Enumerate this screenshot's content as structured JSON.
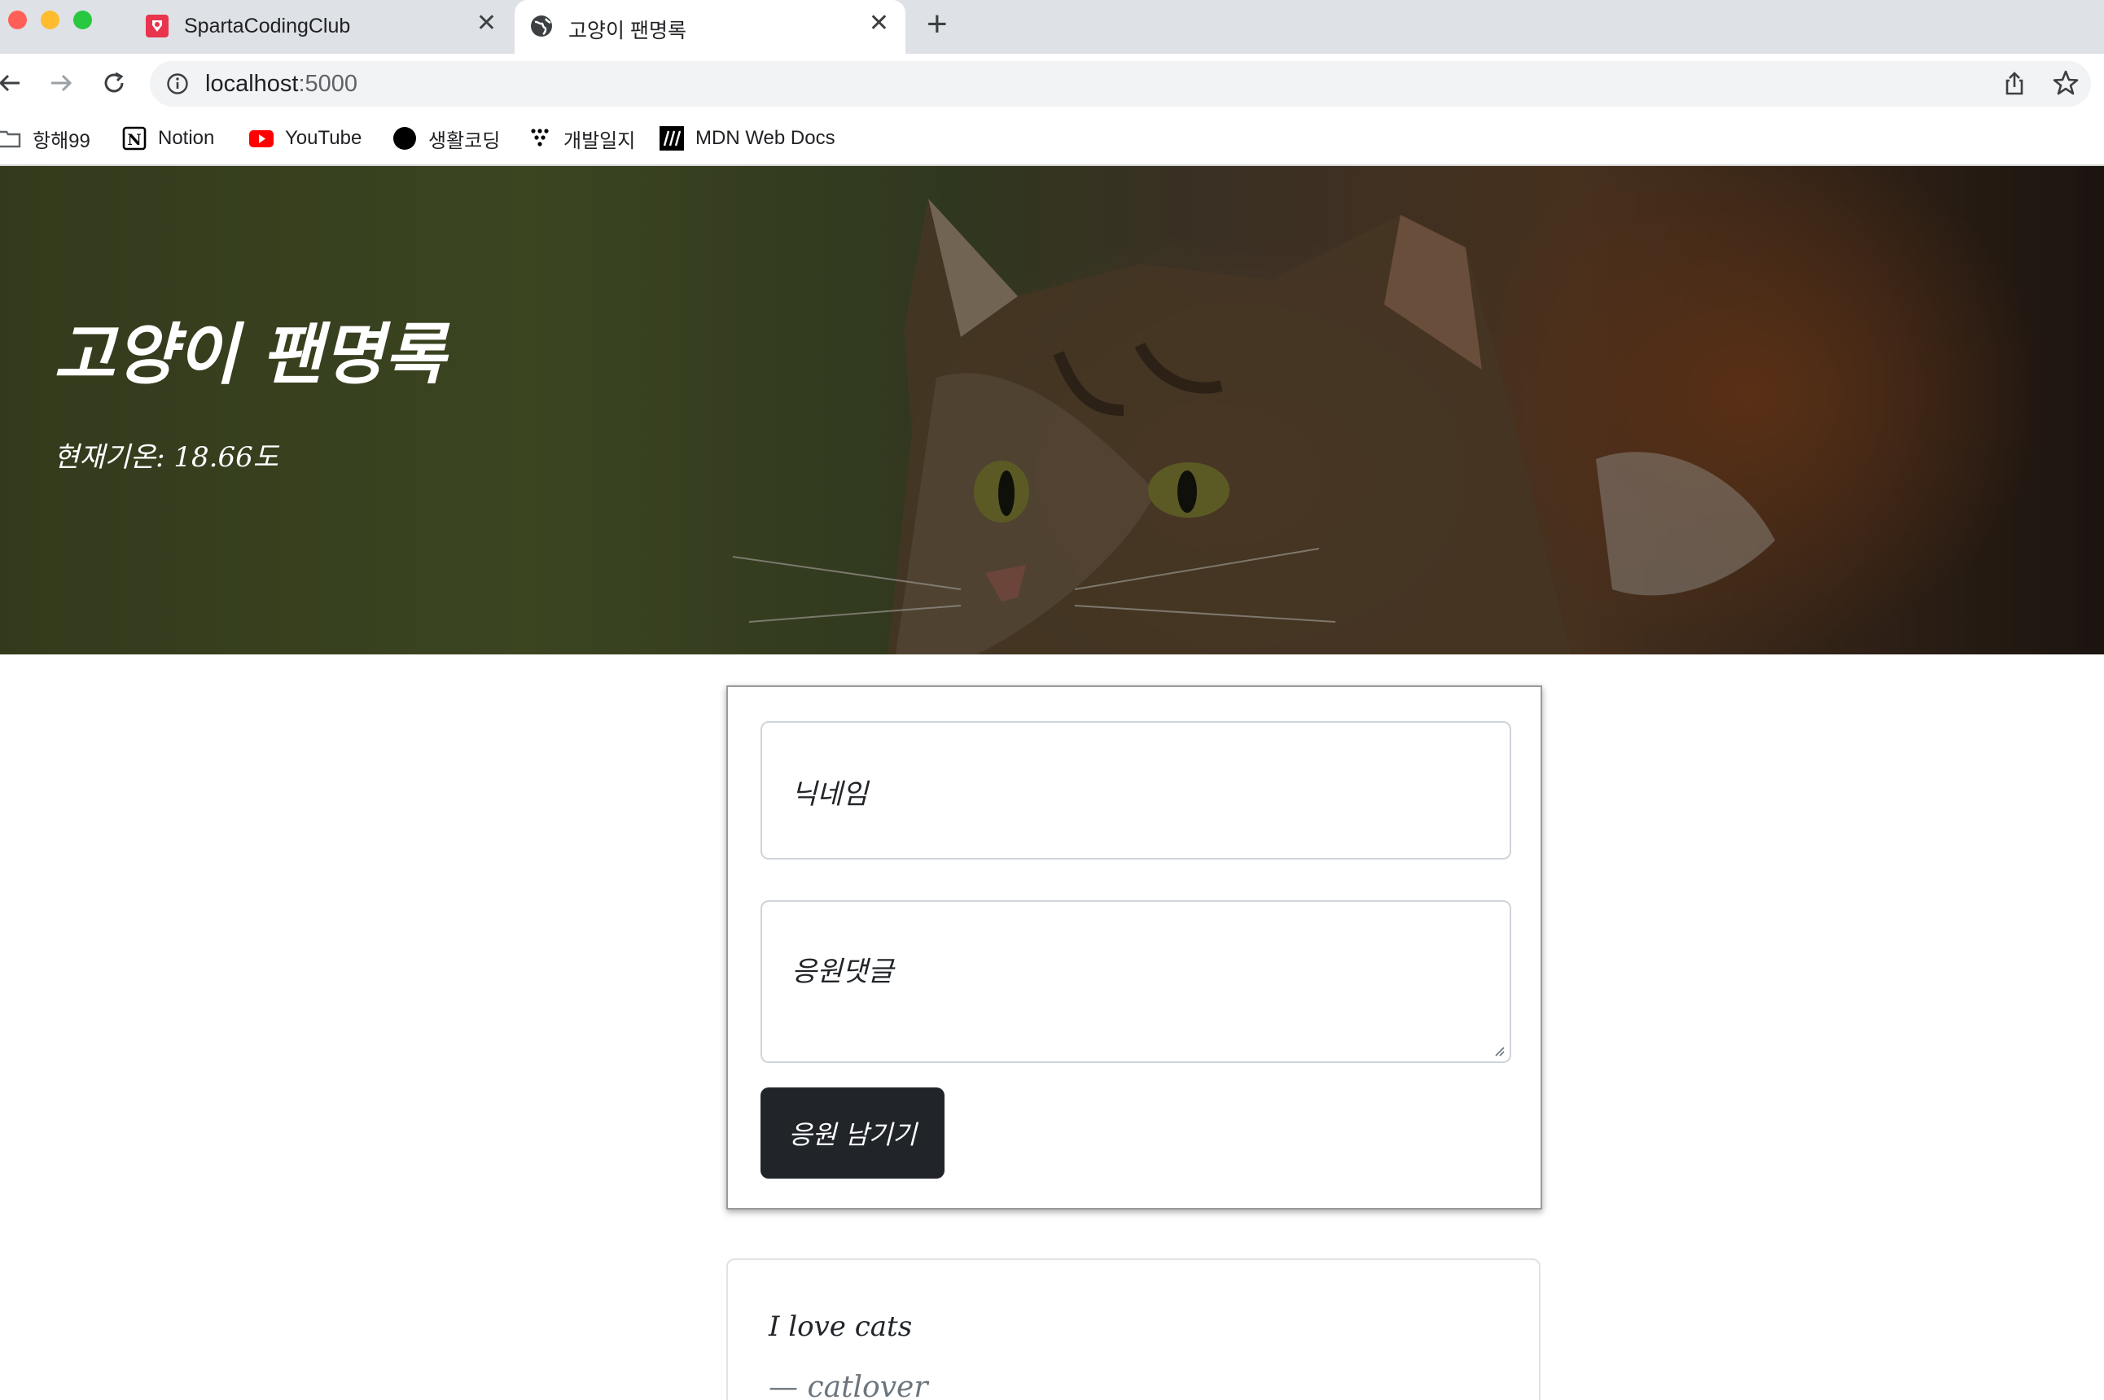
{
  "browser": {
    "tabs": [
      {
        "title": "SpartaCodingClub",
        "icon": "sparta-favicon",
        "close": "✕",
        "active": false
      },
      {
        "title": "고양이 팬명록",
        "icon": "globe-icon",
        "close": "✕",
        "active": true
      }
    ],
    "new_tab": "+",
    "url_host": "localhost",
    "url_port": ":5000",
    "bookmarks": [
      {
        "label": "항해99",
        "icon": "folder-icon"
      },
      {
        "label": "Notion",
        "icon": "notion-icon"
      },
      {
        "label": "YouTube",
        "icon": "youtube-icon"
      },
      {
        "label": "생활코딩",
        "icon": "circle-icon"
      },
      {
        "label": "개발일지",
        "icon": "dots-icon"
      },
      {
        "label": "MDN Web Docs",
        "icon": "mdn-icon"
      }
    ],
    "colors": {
      "tabstrip": "#dee1e6",
      "youtube": "#ff0000",
      "close": "#ff5f57",
      "minimize": "#febc2e",
      "maximize": "#28c840"
    }
  },
  "hero": {
    "title": "고양이 팬명록",
    "temperature": "현재기온: 18.66도"
  },
  "form": {
    "nickname_placeholder": "닉네임",
    "comment_placeholder": "응원댓글",
    "submit_label": "응원 남기기"
  },
  "comments": [
    {
      "text": "I love cats",
      "author": "— catlover"
    }
  ]
}
